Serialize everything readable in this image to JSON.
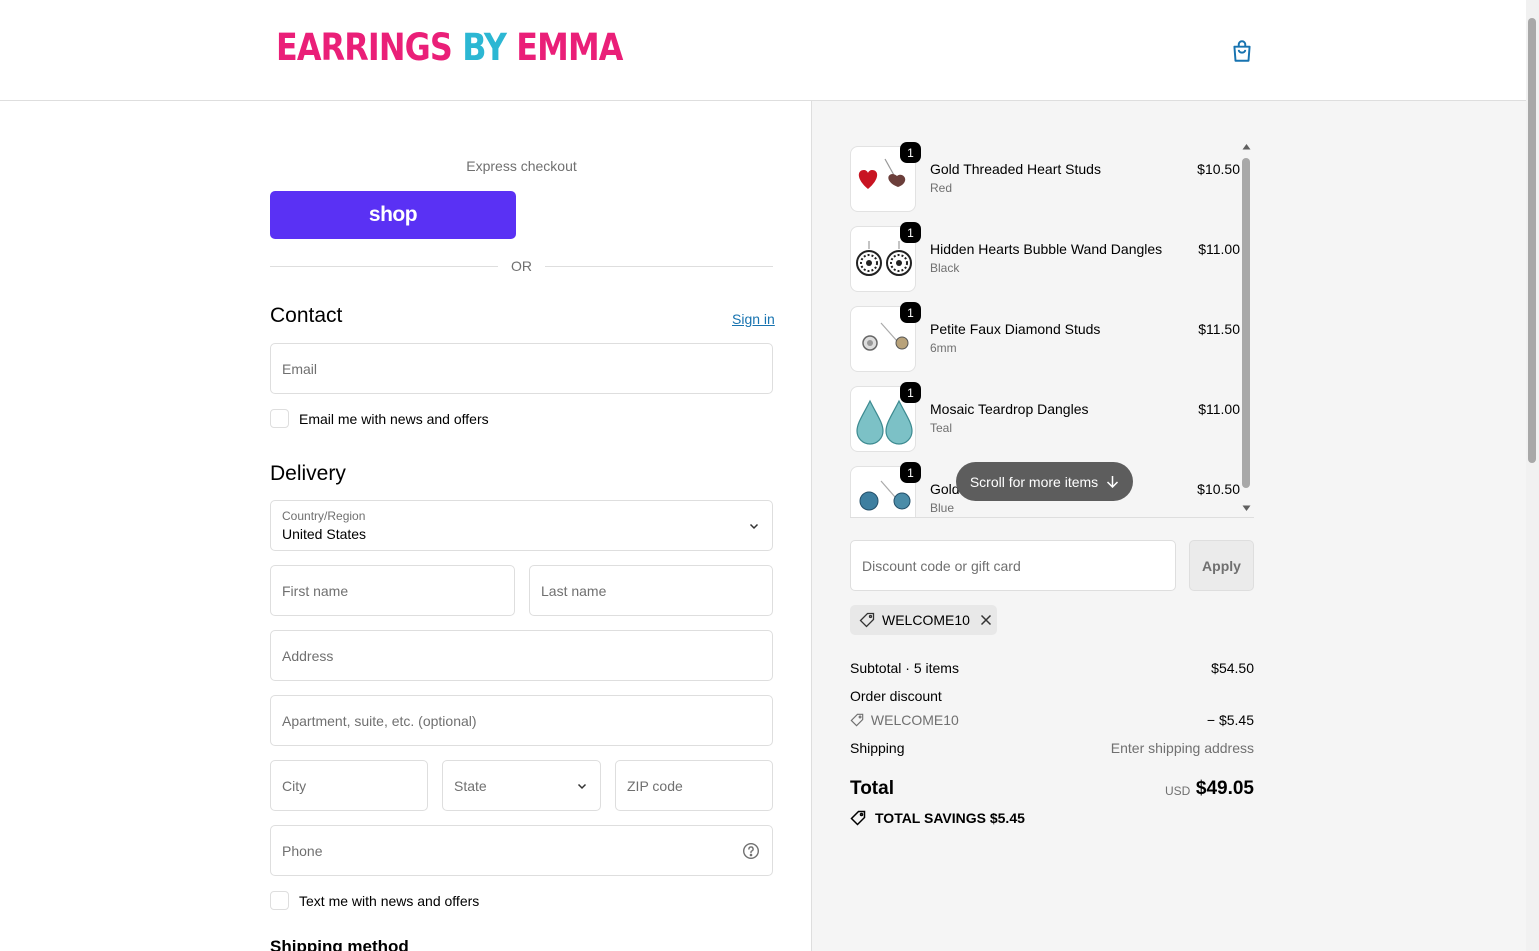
{
  "brand": {
    "part1": "EARRINGS",
    "part2": "BY",
    "part3": "EMMA"
  },
  "express": {
    "label": "Express checkout",
    "shop_label": "shop",
    "or_label": "OR"
  },
  "contact": {
    "title": "Contact",
    "sign_in": "Sign in",
    "email_placeholder": "Email",
    "news_checkbox": "Email me with news and offers"
  },
  "delivery": {
    "title": "Delivery",
    "country_label": "Country/Region",
    "country_value": "United States",
    "first_name": "First name",
    "last_name": "Last name",
    "address": "Address",
    "apartment": "Apartment, suite, etc. (optional)",
    "city": "City",
    "state": "State",
    "zip": "ZIP code",
    "phone": "Phone",
    "sms_checkbox": "Text me with news and offers",
    "shipping_method": "Shipping method"
  },
  "cart": {
    "items": [
      {
        "name": "Gold Threaded Heart Studs",
        "variant": "Red",
        "price": "$10.50",
        "qty": "1"
      },
      {
        "name": "Hidden Hearts Bubble Wand Dangles",
        "variant": "Black",
        "price": "$11.00",
        "qty": "1"
      },
      {
        "name": "Petite Faux Diamond Studs",
        "variant": "6mm",
        "price": "$11.50",
        "qty": "1"
      },
      {
        "name": "Mosaic Teardrop Dangles",
        "variant": "Teal",
        "price": "$11.00",
        "qty": "1"
      },
      {
        "name": "Gold",
        "variant": "Blue",
        "price": "$10.50",
        "qty": "1"
      }
    ],
    "scroll_hint": "Scroll for more items"
  },
  "discount": {
    "placeholder": "Discount code or gift card",
    "apply": "Apply",
    "applied_code": "WELCOME10"
  },
  "summary": {
    "subtotal_label": "Subtotal · 5 items",
    "subtotal_value": "$54.50",
    "order_discount_label": "Order discount",
    "discount_code": "WELCOME10",
    "discount_value": "− $5.45",
    "shipping_label": "Shipping",
    "shipping_value": "Enter shipping address",
    "total_label": "Total",
    "currency": "USD",
    "total_value": "$49.05",
    "savings": "TOTAL SAVINGS  $5.45"
  },
  "colors": {
    "brand_pink": "#ea1f78",
    "brand_blue": "#2cb7d3",
    "shop_purple": "#5a31f4",
    "link": "#1773b0"
  }
}
